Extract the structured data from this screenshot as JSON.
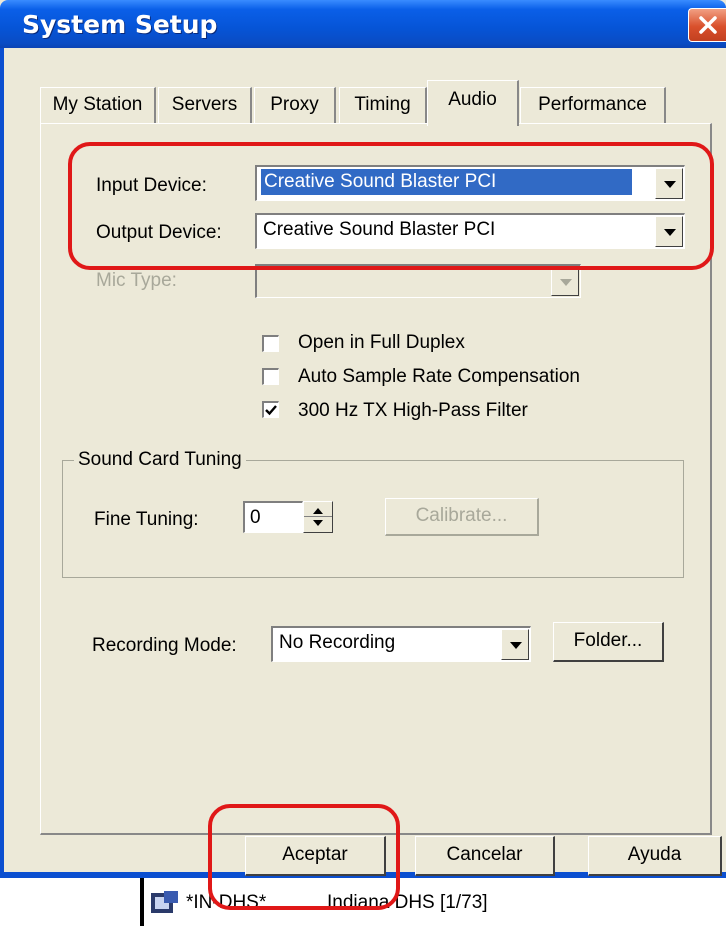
{
  "window": {
    "title": "System Setup"
  },
  "tabs": [
    {
      "label": "My Station"
    },
    {
      "label": "Servers"
    },
    {
      "label": "Proxy"
    },
    {
      "label": "Timing"
    },
    {
      "label": "Audio"
    },
    {
      "label": "Performance"
    }
  ],
  "audio": {
    "input_device_label": "Input Device:",
    "input_device_value": "Creative Sound Blaster PCI",
    "output_device_label": "Output Device:",
    "output_device_value": "Creative Sound Blaster PCI",
    "mic_type_label": "Mic Type:",
    "mic_type_value": "",
    "checkboxes": [
      {
        "label": "Open in Full Duplex",
        "checked": false
      },
      {
        "label": "Auto Sample Rate Compensation",
        "checked": false
      },
      {
        "label": "300 Hz TX High-Pass Filter",
        "checked": true
      }
    ],
    "sound_card_group_label": "Sound Card Tuning",
    "fine_tuning_label": "Fine Tuning:",
    "fine_tuning_value": "0",
    "calibrate_label": "Calibrate...",
    "recording_mode_label": "Recording Mode:",
    "recording_mode_value": "No Recording",
    "folder_label": "Folder..."
  },
  "buttons": {
    "ok": "Aceptar",
    "cancel": "Cancelar",
    "help": "Ayuda"
  },
  "taskbar": {
    "item_code": "*IN-DHS*",
    "item_name": "Indiana DHS [1/73]"
  },
  "colors": {
    "title_bar": "#0654d6",
    "close_button": "#d9502c",
    "dialog_bg": "#ece9d8",
    "selection": "#316ac5",
    "annotation": "#e01818"
  },
  "icons": [
    "close-icon",
    "dropdown-arrow-icon",
    "checkmark-icon",
    "spinner-up-icon",
    "spinner-down-icon",
    "taskbar-app-icon"
  ]
}
